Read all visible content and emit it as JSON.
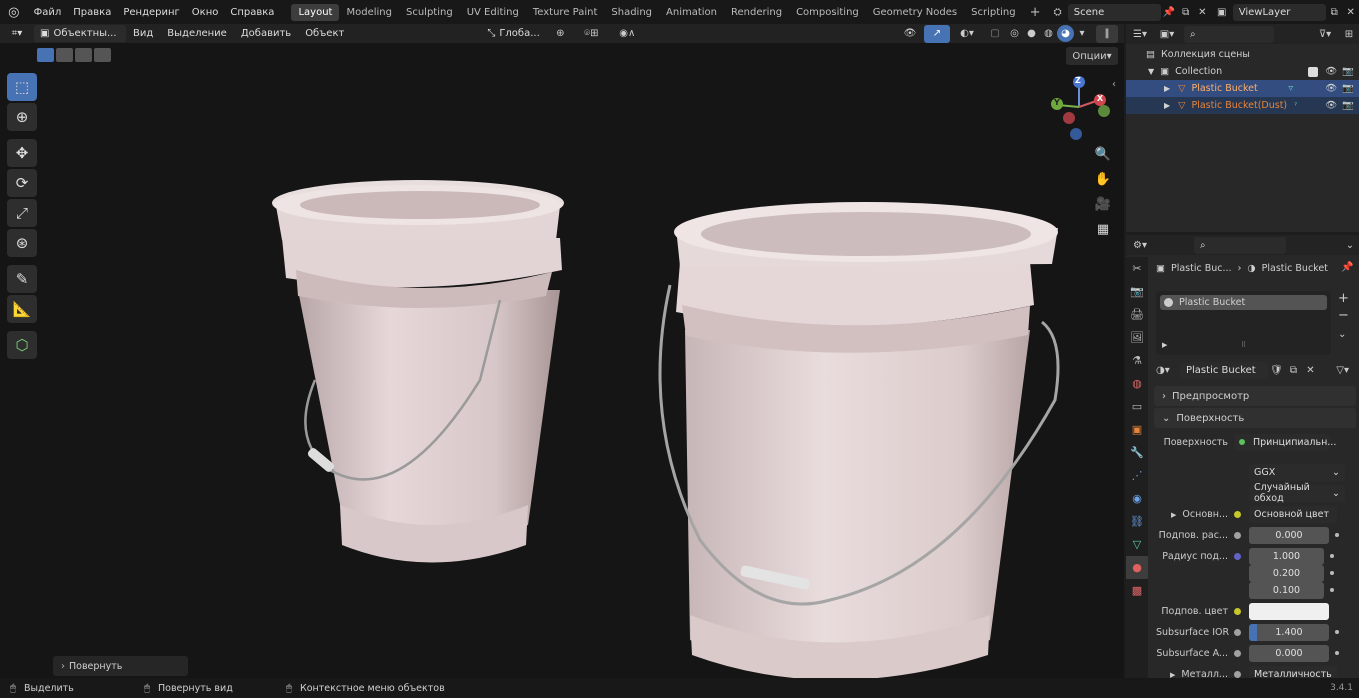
{
  "topbar": {
    "menus": [
      "Файл",
      "Правка",
      "Рендеринг",
      "Окно",
      "Справка"
    ],
    "workspaces": [
      "Layout",
      "Modeling",
      "Sculpting",
      "UV Editing",
      "Texture Paint",
      "Shading",
      "Animation",
      "Rendering",
      "Compositing",
      "Geometry Nodes",
      "Scripting"
    ],
    "active_workspace": "Layout",
    "add_tab": "+",
    "scene": "Scene",
    "view_layer": "ViewLayer"
  },
  "viewport_header": {
    "mode": "Объектны...",
    "menus": [
      "Вид",
      "Выделение",
      "Добавить",
      "Объект"
    ],
    "orientation": "Глоба...",
    "options": "Опции"
  },
  "viewport": {
    "last_operator": "Повернуть",
    "gizmo_axes": {
      "x": "X",
      "y": "Y",
      "z": "Z"
    },
    "bucket_color": "#dcc9c9",
    "handle_color": "#9a9a9a"
  },
  "outliner": {
    "search_placeholder": "",
    "scene_collection": "Коллекция сцены",
    "collection": "Collection",
    "objects": [
      "Plastic Bucket",
      "Plastic Bucket(Dust)"
    ]
  },
  "properties": {
    "breadcrumb_object": "Plastic Buc...",
    "breadcrumb_material": "Plastic Bucket",
    "slot_name": "Plastic Bucket",
    "material_name": "Plastic Bucket",
    "panel_preview": "Предпросмотр",
    "panel_surface": "Поверхность",
    "surface_label": "Поверхность",
    "surface_shader": "Принципиальн...",
    "distribution": "GGX",
    "subsurface_method": "Случайный обход",
    "base_color_label": "Основн...",
    "base_color_value": "Основной цвет",
    "subsurface_label": "Подпов. рас...",
    "subsurface_value": "0.000",
    "radius_label": "Радиус под...",
    "radius_values": [
      "1.000",
      "0.200",
      "0.100"
    ],
    "subsurface_color_label": "Подпов. цвет",
    "subsurface_ior_label": "Subsurface IOR",
    "subsurface_ior_value": "1.400",
    "subsurface_aniso_label": "Subsurface A...",
    "subsurface_aniso_value": "0.000",
    "metallic_label": "Металл...",
    "metallic_value": "Металличность"
  },
  "statusbar": {
    "select": "Выделить",
    "rotate_view": "Повернуть вид",
    "context_menu": "Контекстное меню объектов",
    "version": "3.4.1"
  },
  "colors": {
    "accent": "#4772b3",
    "object_orange": "#e8843a",
    "selected_row": "#334d80"
  }
}
